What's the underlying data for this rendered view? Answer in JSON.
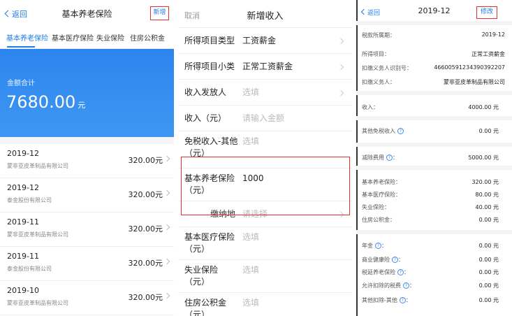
{
  "panel1": {
    "back_label": "返回",
    "title": "基本养老保险",
    "add_label": "新增",
    "tabs": [
      "基本养老保险",
      "基本医疗保险",
      "失业保险",
      "住房公积金"
    ],
    "active_tab": 0,
    "banner": {
      "label": "金额合计",
      "amount": "7680.00",
      "unit": "元"
    },
    "records": [
      {
        "date": "2019-12",
        "company": "蒙非亚皮革制品有限公司",
        "amount": "320.00元"
      },
      {
        "date": "2019-12",
        "company": "泰金股份有限公司",
        "amount": "320.00元"
      },
      {
        "date": "2019-11",
        "company": "蒙非亚皮革制品有限公司",
        "amount": "320.00元"
      },
      {
        "date": "2019-11",
        "company": "泰金股份有限公司",
        "amount": "320.00元"
      },
      {
        "date": "2019-10",
        "company": "蒙非亚皮革制品有限公司",
        "amount": "320.00元"
      }
    ]
  },
  "panel2": {
    "cancel_label": "取消",
    "title": "新增收入",
    "fields": [
      {
        "label": "所得项目类型",
        "value": "工资薪金",
        "placeholder": false,
        "chevron": true
      },
      {
        "label": "所得项目小类",
        "value": "正常工资薪金",
        "placeholder": false,
        "chevron": true
      },
      {
        "label": "收入发放人",
        "value": "选填",
        "placeholder": true,
        "chevron": true
      },
      {
        "label": "收入（元）",
        "value": "请输入金额",
        "placeholder": true,
        "chevron": false
      },
      {
        "label": "免税收入-其他（元）",
        "value": "选填",
        "placeholder": true,
        "chevron": false
      },
      {
        "label": "基本养老保险（元）",
        "value": "1000",
        "placeholder": false,
        "chevron": false
      },
      {
        "label": "缴纳地",
        "value": "请选择",
        "placeholder": true,
        "chevron": true
      },
      {
        "label": "基本医疗保险（元）",
        "value": "选填",
        "placeholder": true,
        "chevron": false
      },
      {
        "label": "失业保险（元）",
        "value": "选填",
        "placeholder": true,
        "chevron": false
      },
      {
        "label": "住房公积金（元）",
        "value": "选填",
        "placeholder": true,
        "chevron": false
      }
    ]
  },
  "panel3": {
    "back_label": "返回",
    "title": "2019-12",
    "edit_label": "修改",
    "rows": [
      {
        "key": "税款所属期：",
        "value": "2019-12"
      },
      {
        "key": "所得项目：",
        "value": "正常工资薪金"
      },
      {
        "key": "扣缴义务人识别号：",
        "value": "46600591234390392207"
      },
      {
        "key": "扣缴义务人：",
        "value": "蒙非亚皮革制品有限公司"
      },
      {
        "key": "收入：",
        "value": "4000.00 元"
      },
      {
        "key": "其他免税收入",
        "value": "0.00 元",
        "help": true
      },
      {
        "key": "减除费用",
        "value": "5000.00 元",
        "help": true,
        "colon": "："
      },
      {
        "key": "基本养老保险：",
        "value": "320.00 元"
      },
      {
        "key": "基本医疗保险：",
        "value": "80.00 元"
      },
      {
        "key": "失业保险：",
        "value": "40.00 元"
      },
      {
        "key": "住房公积金：",
        "value": "0.00 元"
      },
      {
        "key": "年金",
        "value": "0.00 元",
        "help": true,
        "colon": "："
      },
      {
        "key": "商业健康险",
        "value": "0.00 元",
        "help": true,
        "colon": "："
      },
      {
        "key": "税延养老保险",
        "value": "0.00 元",
        "help": true,
        "colon": "："
      },
      {
        "key": "允许扣除的税费",
        "value": "0.00 元",
        "help": true,
        "colon": "："
      },
      {
        "key": "其他扣除-其他",
        "value": "0.00 元",
        "help": true,
        "colon": "："
      }
    ]
  },
  "colors": {
    "accent": "#1e7ee6",
    "highlight": "#e63030",
    "banner": "#3b8ff0"
  }
}
